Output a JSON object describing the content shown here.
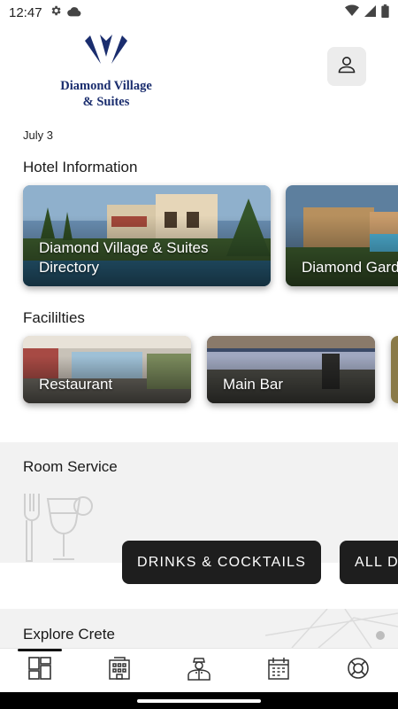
{
  "status_bar": {
    "time": "12:47",
    "left_icons": [
      "gear-icon",
      "cloud-icon"
    ],
    "right_icons": [
      "wifi-icon",
      "signal-icon",
      "battery-icon"
    ]
  },
  "header": {
    "logo_line1": "Diamond Village",
    "logo_line2": "& Suites",
    "brand_color": "#1a2d6e",
    "profile_icon": "user-icon"
  },
  "date": "July 3",
  "hotel_information": {
    "title": "Hotel Information",
    "cards": [
      {
        "label_line1": "Diamond Village & Suites",
        "label_line2": "Directory"
      },
      {
        "label_line1": "Diamond Gard"
      }
    ]
  },
  "facilities": {
    "title": "Facililties",
    "cards": [
      {
        "label": "Restaurant"
      },
      {
        "label": "Main Bar"
      }
    ]
  },
  "room_service": {
    "title": "Room Service",
    "icon": "drink-utensils-icon",
    "buttons": [
      {
        "label": "DRINKS & COCKTAILS"
      },
      {
        "label": "ALL D"
      }
    ]
  },
  "explore": {
    "title": "Explore Crete"
  },
  "bottom_nav": {
    "items": [
      {
        "icon": "dashboard-icon",
        "active": true
      },
      {
        "icon": "hotel-building-icon"
      },
      {
        "icon": "concierge-staff-icon"
      },
      {
        "icon": "calendar-icon"
      },
      {
        "icon": "lifebuoy-icon"
      }
    ]
  }
}
